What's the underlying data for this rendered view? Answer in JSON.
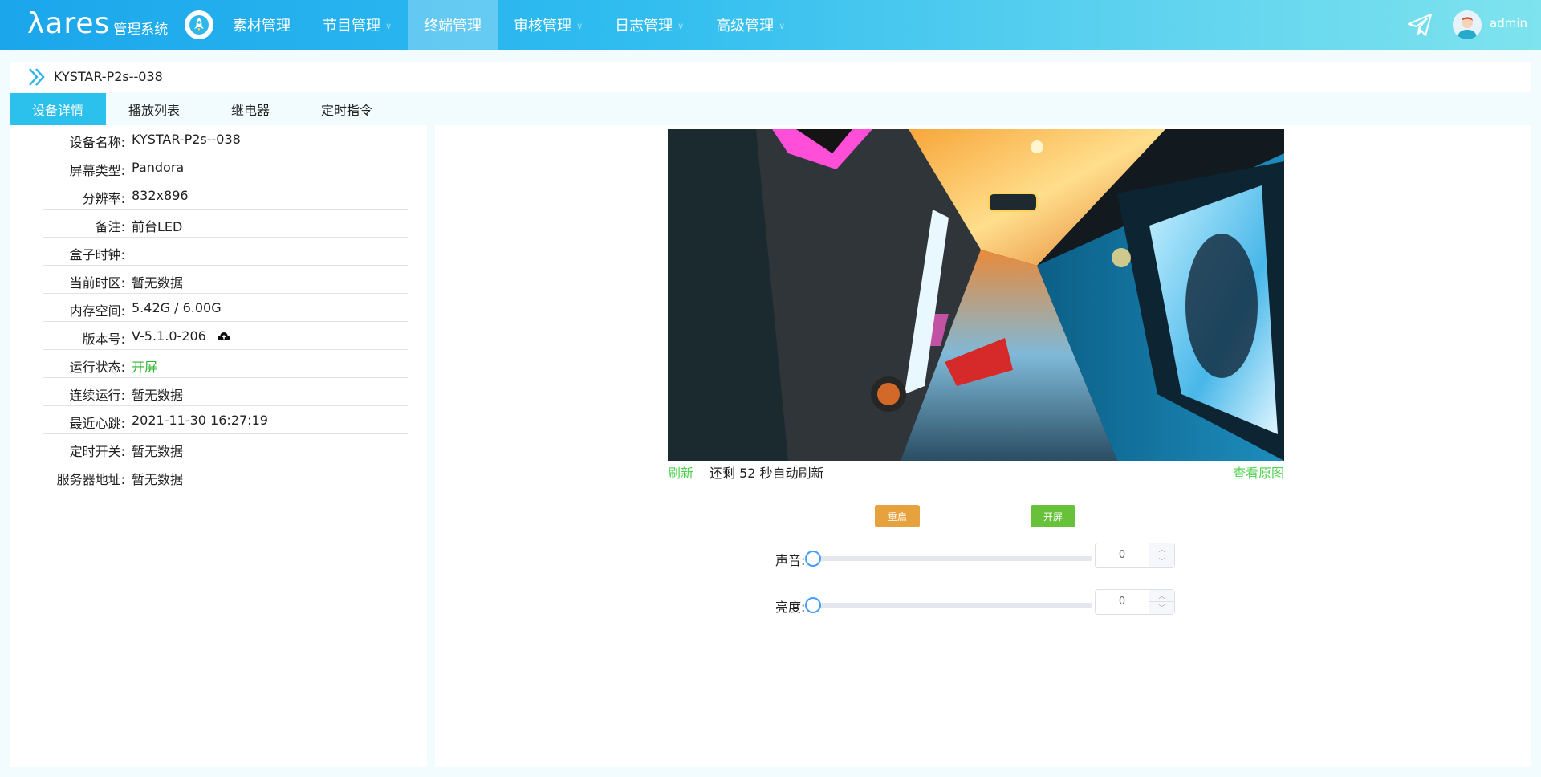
{
  "header": {
    "logo_main": "λares",
    "logo_sub": "管理系统",
    "nav": [
      {
        "label": "素材管理",
        "dropdown": false,
        "active": false
      },
      {
        "label": "节目管理",
        "dropdown": true,
        "active": false
      },
      {
        "label": "终端管理",
        "dropdown": false,
        "active": true
      },
      {
        "label": "审核管理",
        "dropdown": true,
        "active": false
      },
      {
        "label": "日志管理",
        "dropdown": true,
        "active": false
      },
      {
        "label": "高级管理",
        "dropdown": true,
        "active": false
      }
    ],
    "user": "admin"
  },
  "breadcrumb": {
    "title": "KYSTAR-P2s--038"
  },
  "tabs": [
    {
      "label": "设备详情",
      "active": true
    },
    {
      "label": "播放列表",
      "active": false
    },
    {
      "label": "继电器",
      "active": false
    },
    {
      "label": "定时指令",
      "active": false
    }
  ],
  "details": [
    {
      "label": "设备名称:",
      "value": "KYSTAR-P2s--038"
    },
    {
      "label": "屏幕类型:",
      "value": "Pandora"
    },
    {
      "label": "分辨率:",
      "value": "832x896"
    },
    {
      "label": "备注:",
      "value": "前台LED"
    },
    {
      "label": "盒子时钟:",
      "value": ""
    },
    {
      "label": "当前时区:",
      "value": "暂无数据"
    },
    {
      "label": "内存空间:",
      "value": "5.42G / 6.00G"
    },
    {
      "label": "版本号:",
      "value": "V-5.1.0-206"
    },
    {
      "label": "运行状态:",
      "value": "开屏"
    },
    {
      "label": "连续运行:",
      "value": "暂无数据"
    },
    {
      "label": "最近心跳:",
      "value": "2021-11-30 16:27:19"
    },
    {
      "label": "定时开关:",
      "value": "暂无数据"
    },
    {
      "label": "服务器地址:",
      "value": "暂无数据"
    }
  ],
  "preview": {
    "refresh_label": "刷新",
    "countdown_text": "还剩 52 秒自动刷新",
    "view_original_label": "查看原图"
  },
  "controls": {
    "restart_label": "重启",
    "screen_on_label": "开屏",
    "volume": {
      "label": "声音:",
      "value": 0,
      "value_text": "0"
    },
    "brightness": {
      "label": "亮度:",
      "value": 0,
      "value_text": "0"
    }
  },
  "colors": {
    "accent": "#2cc0ec",
    "status_green": "#2fb52f",
    "link_green": "#4cd14c",
    "restart": "#e6a23c",
    "screen_on": "#67c23a",
    "slider": "#409eff"
  }
}
